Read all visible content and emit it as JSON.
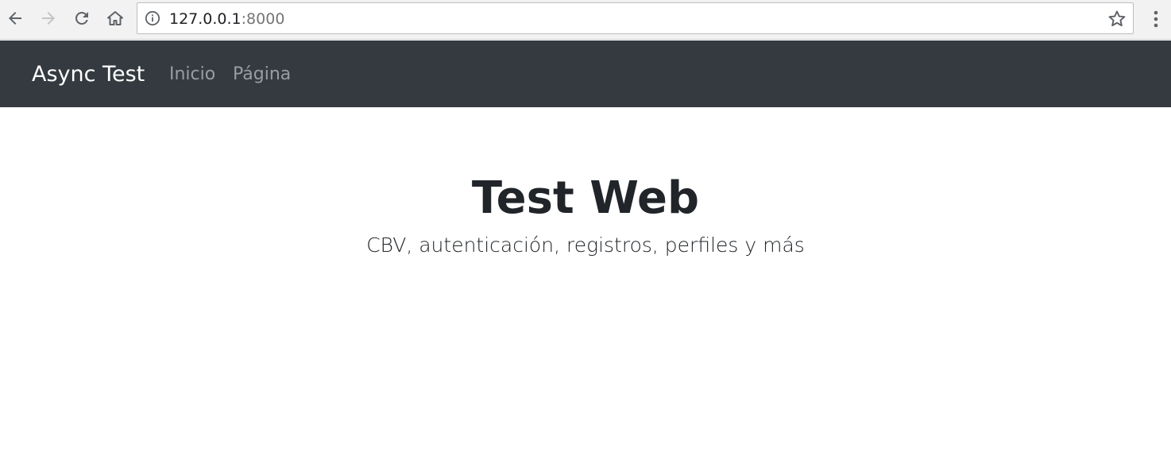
{
  "browser": {
    "url_host": "127.0.0.1",
    "url_port": ":8000",
    "icons": {
      "back": "back-arrow-icon",
      "forward": "forward-arrow-icon",
      "reload": "reload-icon",
      "home": "home-icon",
      "info": "info-icon",
      "bookmark": "star-icon",
      "menu": "more-vert-icon"
    }
  },
  "navbar": {
    "brand": "Async Test",
    "links": [
      {
        "label": "Inicio"
      },
      {
        "label": "Página"
      }
    ],
    "background": "#343a40",
    "link_color": "#9a9da0"
  },
  "hero": {
    "title": "Test Web",
    "subtitle": "CBV, autenticación, registros, perfiles y más"
  }
}
